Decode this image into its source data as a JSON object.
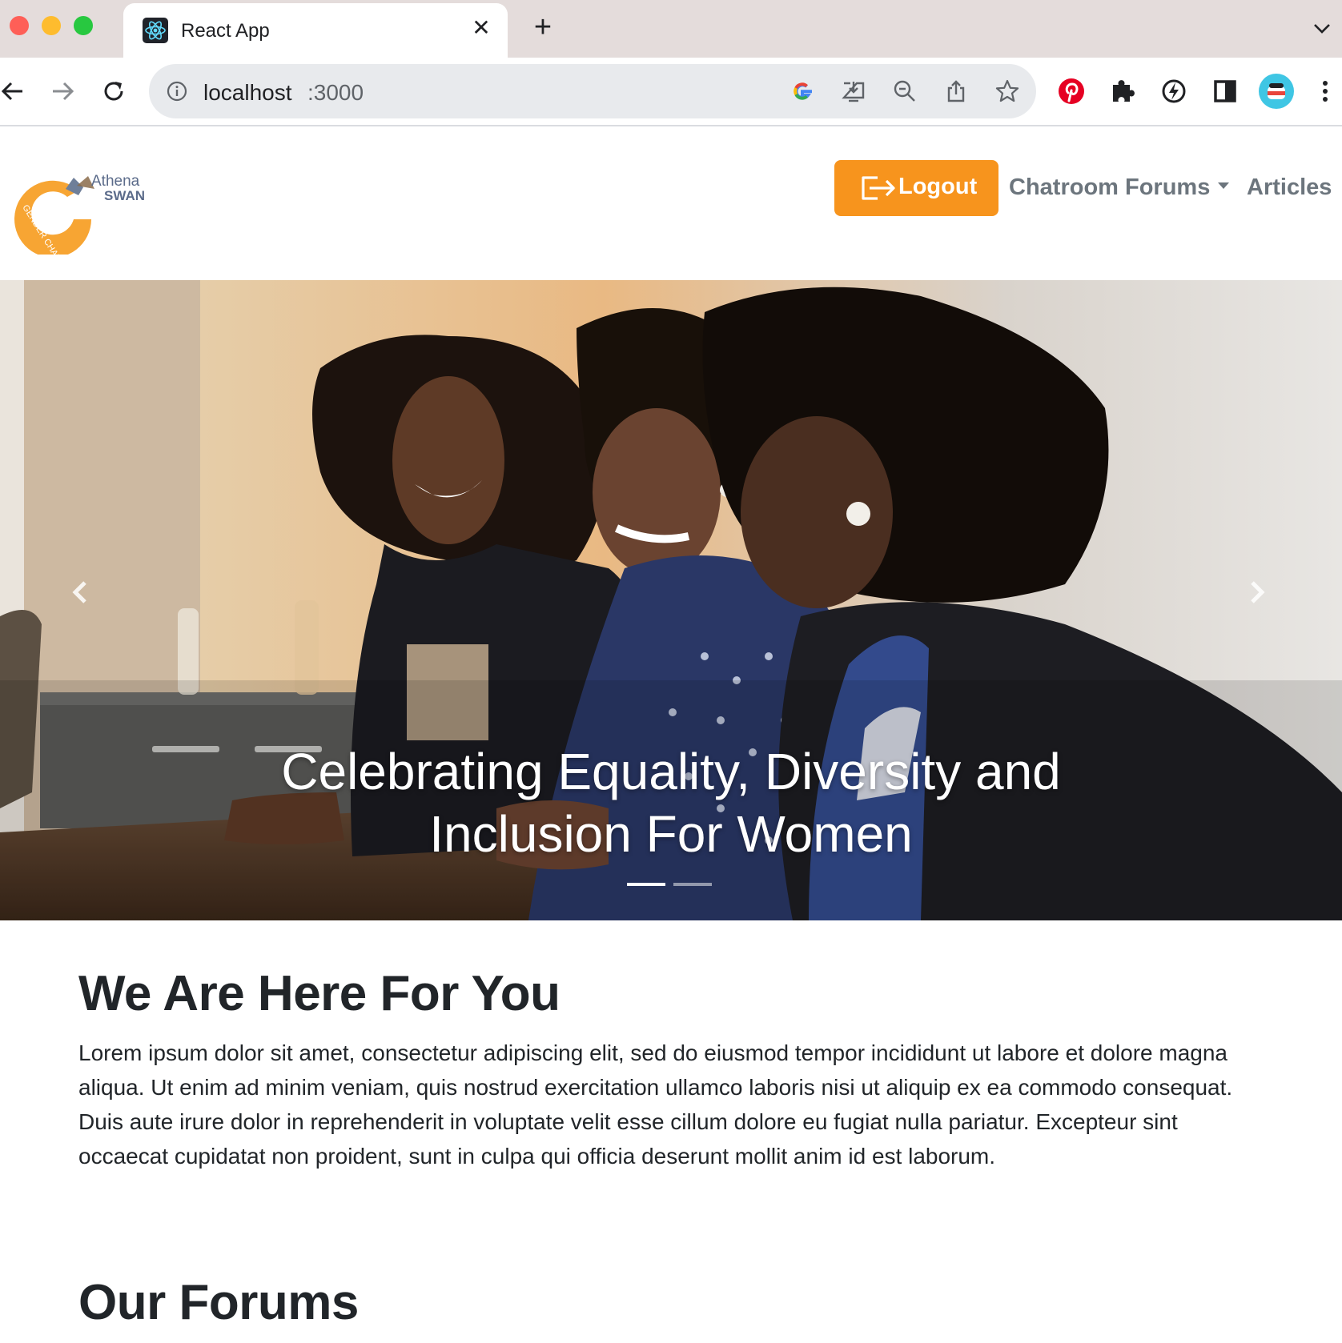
{
  "browser": {
    "tab_title": "React App",
    "tab_close": "✕",
    "new_tab": "+",
    "url_host": "localhost",
    "url_port": ":3000"
  },
  "navbar": {
    "logo_text_1": "Athena",
    "logo_text_2": "SWAN",
    "logo_text_3": "GENDER CHARTER",
    "logout_label": "Logout",
    "forums_label": "Chatroom Forums",
    "articles_label": "Articles"
  },
  "carousel": {
    "caption_line1": "Celebrating Equality, Diversity and",
    "caption_line2": "Inclusion For Women"
  },
  "main": {
    "intro_title": "We Are Here For You",
    "intro_body": "Lorem ipsum dolor sit amet, consectetur adipiscing elit, sed do eiusmod tempor incididunt ut labore et dolore magna aliqua. Ut enim ad minim veniam, quis nostrud exercitation ullamco laboris nisi ut aliquip ex ea commodo consequat. Duis aute irure dolor in reprehenderit in voluptate velit esse cillum dolore eu fugiat nulla pariatur. Excepteur sint occaecat cupidatat non proident, sunt in culpa qui officia deserunt mollit anim id est laborum.",
    "forums_title": "Our Forums"
  },
  "colors": {
    "accent": "#f7941d",
    "nav_text": "#6c757d",
    "body_text": "#212529",
    "tabstrip": "#e4dcdb"
  },
  "icons": [
    "react-icon",
    "close-icon",
    "plus-icon",
    "chevron-down-icon",
    "back-arrow-icon",
    "forward-arrow-icon",
    "reload-icon",
    "info-icon",
    "google-icon",
    "install-icon",
    "zoom-out-icon",
    "share-icon",
    "star-icon",
    "pinterest-icon",
    "puzzle-icon",
    "bolt-icon",
    "sidebar-icon",
    "avatar",
    "more-vert-icon",
    "logout-icon",
    "chevron-left-icon",
    "chevron-right-icon"
  ]
}
